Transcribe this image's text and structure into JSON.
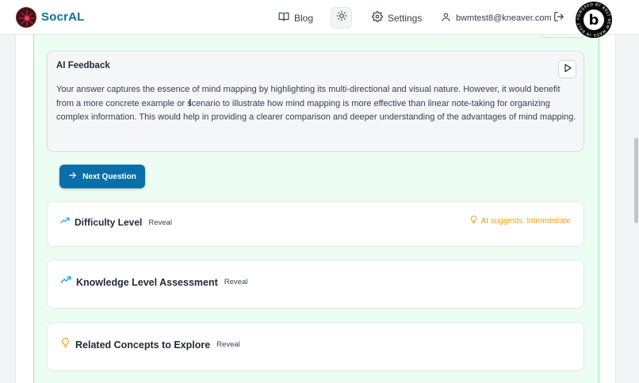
{
  "header": {
    "app_name": "SocrAL",
    "nav": {
      "blog_label": "Blog",
      "settings_label": "Settings",
      "user_email": "bwmtest8@kneaver.com"
    },
    "bolt_badge_text": "POWERED BY BOLT NEW MADE IN BOLT"
  },
  "feedback": {
    "title": "AI Feedback",
    "text": "Your answer captures the essence of mind mapping by highlighting its multi-directional and visual nature. However, it would benefit from a more concrete example or scenario to illustrate how mind mapping is more effective than linear note-taking for organizing complex information. This would help in providing a clearer comparison and deeper understanding of the advantages of mind mapping."
  },
  "next_button_label": "Next Question",
  "cards": {
    "difficulty": {
      "title": "Difficulty Level",
      "reveal": "Reveal",
      "ai_suggestion": "AI suggests: Intermediate"
    },
    "knowledge": {
      "title": "Knowledge Level Assessment",
      "reveal": "Reveal"
    },
    "related": {
      "title": "Related Concepts to Explore",
      "reveal": "Reveal"
    }
  },
  "colors": {
    "brand": "#0e6e9c",
    "primary_button": "#0a6fa8",
    "accent_trend": "#0ea5e9",
    "suggestion": "#f59e0b",
    "panel_bg": "#ecfdf3"
  }
}
